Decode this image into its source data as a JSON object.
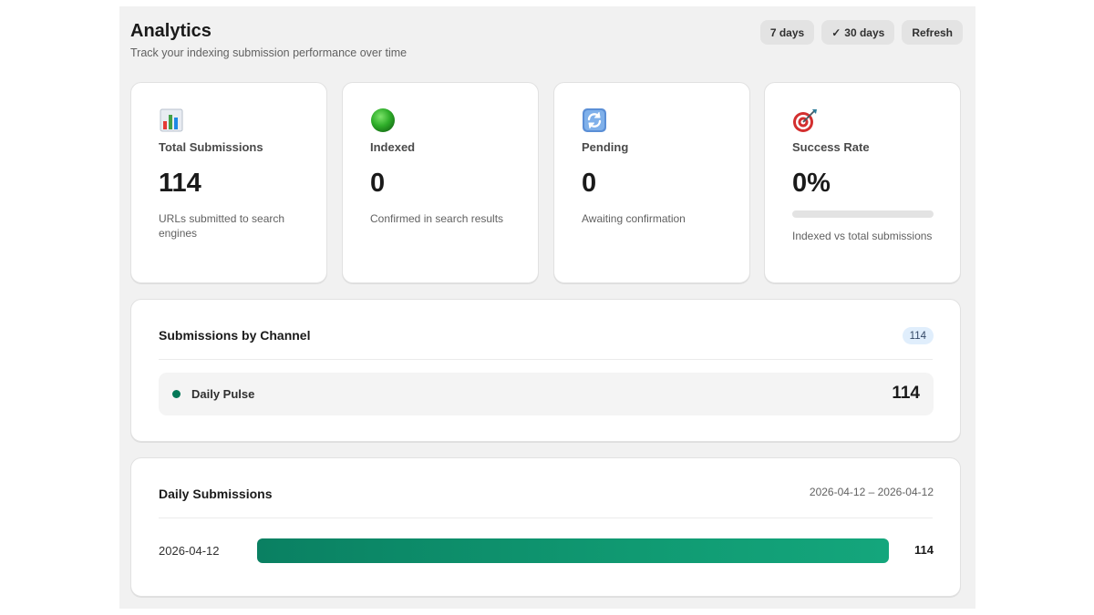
{
  "header": {
    "title": "Analytics",
    "subtitle": "Track your indexing submission performance over time"
  },
  "actions": {
    "range_7": "7 days",
    "range_30": "30 days",
    "range_30_selected": true,
    "refresh": "Refresh"
  },
  "stats": [
    {
      "icon": "bar-chart-icon",
      "label": "Total Submissions",
      "value": "114",
      "desc": "URLs submitted to search engines"
    },
    {
      "icon": "green-circle-icon",
      "label": "Indexed",
      "value": "0",
      "desc": "Confirmed in search results"
    },
    {
      "icon": "refresh-arrows-icon",
      "label": "Pending",
      "value": "0",
      "desc": "Awaiting confirmation"
    },
    {
      "icon": "target-icon",
      "label": "Success Rate",
      "value": "0%",
      "desc": "Indexed vs total submissions",
      "progress": 0
    }
  ],
  "channels": {
    "title": "Submissions by Channel",
    "count": "114",
    "items": [
      {
        "name": "Daily Pulse",
        "value": "114",
        "color": "#047857"
      }
    ]
  },
  "daily": {
    "title": "Daily Submissions",
    "range": "2026-04-12 – 2026-04-12",
    "rows": [
      {
        "date": "2026-04-12",
        "value": "114",
        "fraction": 1.0
      }
    ]
  },
  "colors": {
    "accent": "#008060",
    "bar": "#0f9a72",
    "badge_bg": "#e0eefc"
  }
}
